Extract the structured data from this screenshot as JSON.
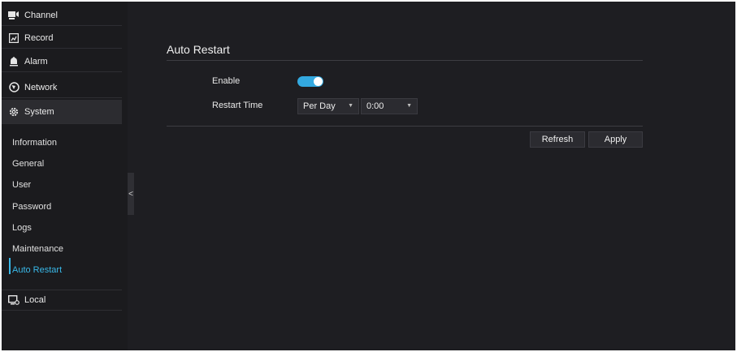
{
  "sidebar": {
    "menu": [
      {
        "label": "Channel",
        "icon": "channel-icon"
      },
      {
        "label": "Record",
        "icon": "record-icon"
      },
      {
        "label": "Alarm",
        "icon": "alarm-icon"
      },
      {
        "label": "Network",
        "icon": "network-icon"
      },
      {
        "label": "System",
        "icon": "gear-icon",
        "active": true
      }
    ],
    "system_submenu": [
      "Information",
      "General",
      "User",
      "Password",
      "Logs",
      "Maintenance",
      "Auto Restart"
    ],
    "active_submenu": "Auto Restart",
    "local": {
      "label": "Local",
      "icon": "local-icon"
    },
    "collapse_glyph": "<"
  },
  "main": {
    "section_title": "Auto Restart",
    "enable_label": "Enable",
    "enable_on": true,
    "restart_time_label": "Restart Time",
    "frequency_value": "Per Day",
    "time_value": "0:00",
    "caret": "▼",
    "refresh_label": "Refresh",
    "apply_label": "Apply"
  },
  "colors": {
    "accent": "#39b8e8",
    "toggle_on": "#33a9e0",
    "background": "#1e1e22",
    "sidebar": "#1b1b1e"
  }
}
